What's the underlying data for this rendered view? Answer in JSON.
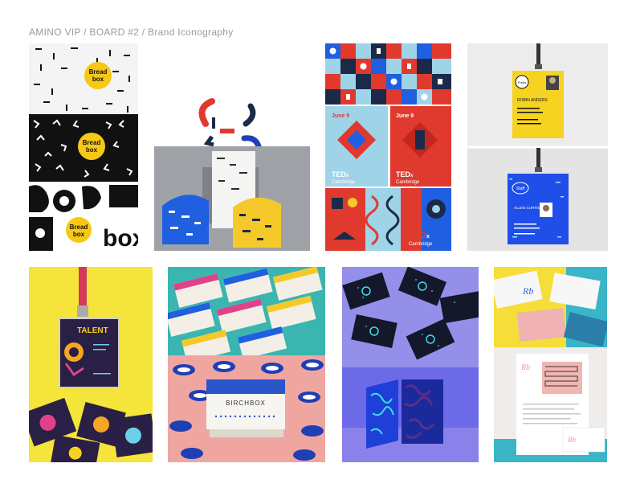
{
  "header": {
    "title": "AMINO VIP / BOARD #2 / Brand Iconography"
  },
  "tiles": {
    "boxbrand": {
      "logo_line1": "Bread",
      "logo_line2": "box",
      "big_word": "box"
    },
    "ted": {
      "brand": "TED",
      "sup": "x",
      "city": "Cambridge",
      "date": "June 9"
    },
    "badge": {
      "staff": "Staff",
      "press": "Press",
      "name1": "ROBIN ANDERS",
      "name2": "ALLEN CURTIS"
    },
    "talent": {
      "word": "TALENT"
    },
    "birchbox": {
      "word": "BIRCHBOX"
    }
  },
  "colors": {
    "teal": "#3ab5b0",
    "red": "#e03a2f",
    "blue": "#1f5fe0",
    "yellow": "#f5c92a",
    "navy": "#1c2a4a"
  }
}
